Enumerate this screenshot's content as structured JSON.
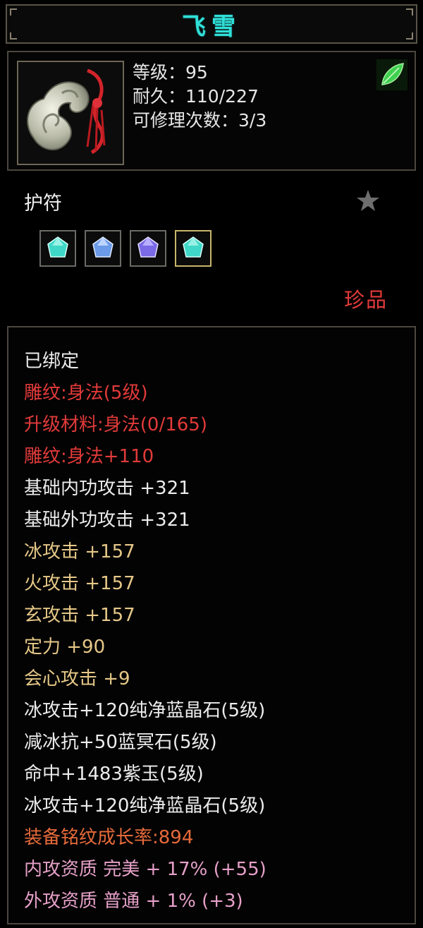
{
  "item": {
    "name": "飞雪",
    "level_line": "等级：95",
    "durability_line": "耐久：110/227",
    "repair_line": "可修理次数：3/3",
    "type": "护符",
    "rarity": "珍品"
  },
  "slots": [
    {
      "gem": "cyan-gem-icon",
      "color": "#3fd8c8"
    },
    {
      "gem": "blue-gem-icon",
      "color": "#6a9ae8"
    },
    {
      "gem": "purple-gem-icon",
      "color": "#7a6ae6"
    },
    {
      "gem": "cyan-gem-icon",
      "color": "#3fd8c8"
    }
  ],
  "attributes": [
    {
      "text": "已绑定",
      "style": "white"
    },
    {
      "text": "雕纹:身法(5级)",
      "style": "red"
    },
    {
      "text": "升级材料:身法(0/165)",
      "style": "red"
    },
    {
      "text": "雕纹:身法+110",
      "style": "red"
    },
    {
      "text": "基础内功攻击 +321",
      "style": "white"
    },
    {
      "text": "基础外功攻击 +321",
      "style": "white"
    },
    {
      "text": "冰攻击 +157",
      "style": "gold"
    },
    {
      "text": "火攻击 +157",
      "style": "gold"
    },
    {
      "text": "玄攻击 +157",
      "style": "gold"
    },
    {
      "text": "定力 +90",
      "style": "gold"
    },
    {
      "text": "会心攻击 +9",
      "style": "gold"
    },
    {
      "text": "冰攻击+120纯净蓝晶石(5级)",
      "style": "white"
    },
    {
      "text": "减冰抗+50蓝冥石(5级)",
      "style": "white"
    },
    {
      "text": "命中+1483紫玉(5级)",
      "style": "white"
    },
    {
      "text": "冰攻击+120纯净蓝晶石(5级)",
      "style": "white"
    },
    {
      "text": "装备铭纹成长率:894",
      "style": "orange"
    },
    {
      "text": "内攻资质 完美 + 17% (+55)",
      "style": "pink"
    },
    {
      "text": "外攻资质 普通 + 1% (+3)",
      "style": "pink"
    }
  ],
  "colors": {
    "title": "#2fe0d8",
    "red": "#e23a3a",
    "gold": "#e6c888",
    "orange": "#e66a3a",
    "pink": "#e6a0c8"
  }
}
